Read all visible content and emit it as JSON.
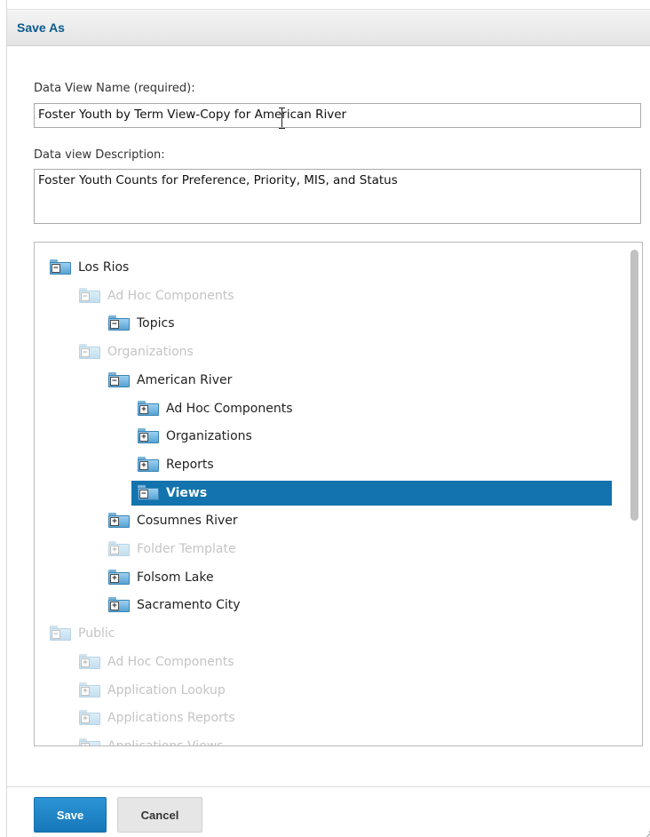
{
  "dialog": {
    "title": "Save As"
  },
  "form": {
    "name_label": "Data View Name (required):",
    "name_value": "Foster Youth by Term View-Copy for American River",
    "description_label": "Data view Description:",
    "description_value": "Foster Youth Counts for Preference, Priority, MIS, and Status"
  },
  "tree": {
    "items": [
      {
        "label": "Los Rios",
        "expanded": true,
        "dim": false,
        "selected": false
      },
      {
        "label": "Ad Hoc Components",
        "expanded": true,
        "dim": true,
        "selected": false
      },
      {
        "label": "Topics",
        "expanded": true,
        "dim": false,
        "selected": false
      },
      {
        "label": "Organizations",
        "expanded": true,
        "dim": true,
        "selected": false
      },
      {
        "label": "American River",
        "expanded": true,
        "dim": false,
        "selected": false
      },
      {
        "label": "Ad Hoc Components",
        "expanded": false,
        "dim": false,
        "selected": false
      },
      {
        "label": "Organizations",
        "expanded": false,
        "dim": false,
        "selected": false
      },
      {
        "label": "Reports",
        "expanded": false,
        "dim": false,
        "selected": false
      },
      {
        "label": "Views",
        "expanded": true,
        "dim": false,
        "selected": true
      },
      {
        "label": "Cosumnes River",
        "expanded": false,
        "dim": false,
        "selected": false
      },
      {
        "label": "Folder Template",
        "expanded": false,
        "dim": true,
        "selected": false
      },
      {
        "label": "Folsom Lake",
        "expanded": false,
        "dim": false,
        "selected": false
      },
      {
        "label": "Sacramento City",
        "expanded": false,
        "dim": false,
        "selected": false
      },
      {
        "label": "Public",
        "expanded": true,
        "dim": true,
        "selected": false
      },
      {
        "label": "Ad Hoc Components",
        "expanded": false,
        "dim": true,
        "selected": false
      },
      {
        "label": "Application Lookup",
        "expanded": false,
        "dim": true,
        "selected": false
      },
      {
        "label": "Applications Reports",
        "expanded": false,
        "dim": true,
        "selected": false
      },
      {
        "label": "Applications Views",
        "expanded": false,
        "dim": true,
        "selected": false
      }
    ],
    "icon": "folder-icon"
  },
  "buttons": {
    "save_label": "Save",
    "cancel_label": "Cancel"
  },
  "colors": {
    "accent": "#1273ae",
    "title": "#0a5a8c"
  }
}
